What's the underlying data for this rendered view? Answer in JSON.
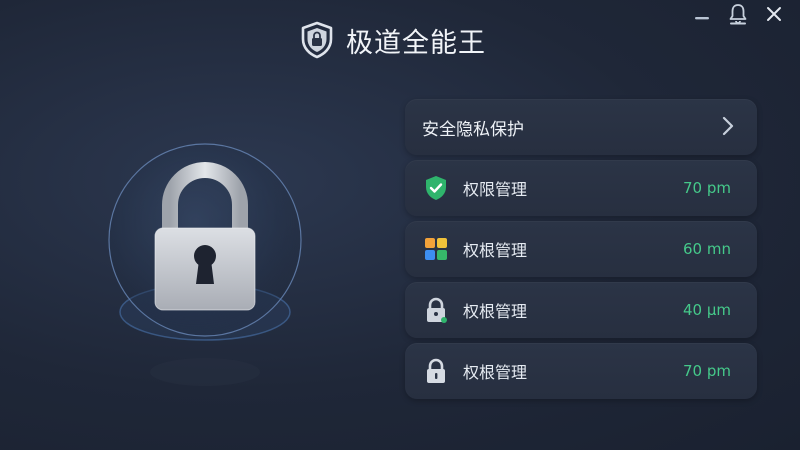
{
  "app": {
    "title": "极道全能王"
  },
  "window": {
    "minimize_icon": "minimize-icon",
    "bell_icon": "bell-icon",
    "close_icon": "close-icon"
  },
  "hero": {
    "icon": "padlock-icon"
  },
  "panel": {
    "header": {
      "label": "安全隐私保护",
      "icon": "chevron-right-icon"
    },
    "items": [
      {
        "label": "权限管理",
        "value": "70 pm",
        "icon": "shield-check-icon"
      },
      {
        "label": "权根管理",
        "value": "60 mn",
        "icon": "app-grid-icon"
      },
      {
        "label": "权根管理",
        "value": "40 µm",
        "icon": "lock-small-icon"
      },
      {
        "label": "权根管理",
        "value": "70 pm",
        "icon": "lock-icon"
      }
    ]
  },
  "colors": {
    "accent_green": "#45c98a",
    "background": "#1f2738",
    "row_bg": "#2b3446"
  }
}
